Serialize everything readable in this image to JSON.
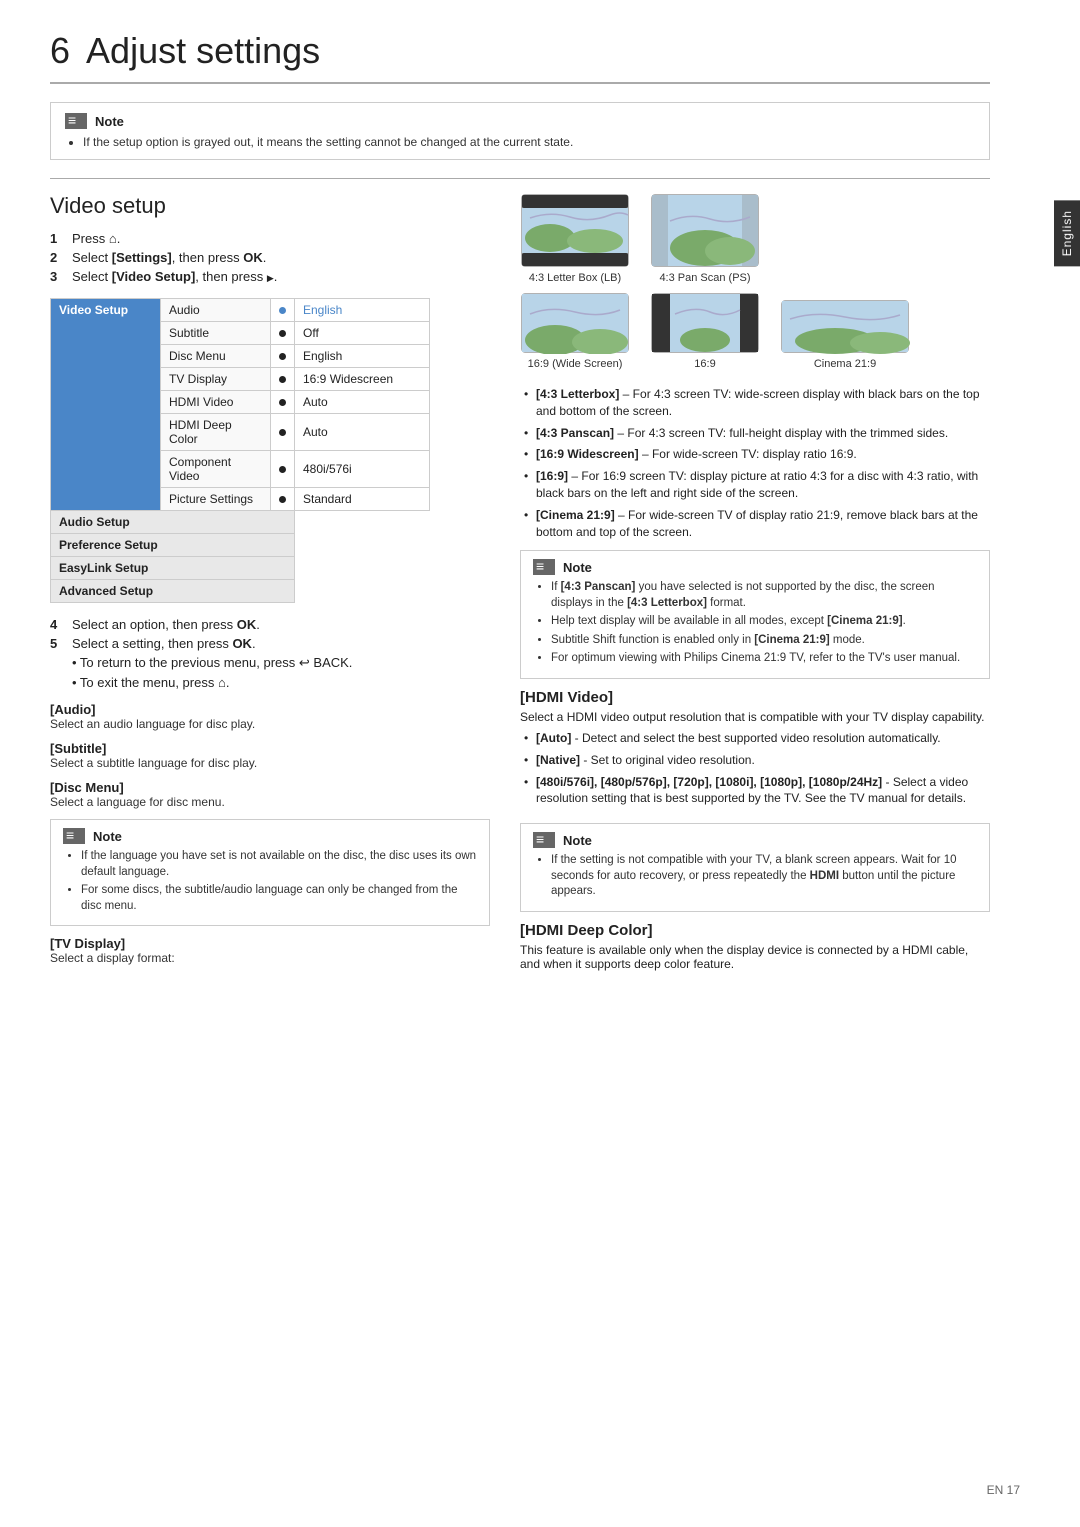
{
  "sidetab": {
    "label": "English"
  },
  "heading": {
    "number": "6",
    "title": "Adjust settings"
  },
  "main_note": {
    "title": "Note",
    "bullets": [
      "If the setup option is grayed out, it means the setting cannot be changed at the current state."
    ]
  },
  "video_setup_section": {
    "title": "Video setup",
    "steps": [
      {
        "num": "1",
        "text": "Press ",
        "icon": "home"
      },
      {
        "num": "2",
        "text": "Select [Settings], then press OK."
      },
      {
        "num": "3",
        "text": "Select [Video Setup], then press ",
        "icon": "arrow-right"
      }
    ],
    "table": {
      "menu_items": [
        {
          "label": "Video Setup",
          "selected": true
        },
        {
          "label": "Audio Setup",
          "selected": false
        },
        {
          "label": "Preference Setup",
          "selected": false
        },
        {
          "label": "EasyLink Setup",
          "selected": false
        },
        {
          "label": "Advanced Setup",
          "selected": false
        }
      ],
      "settings": [
        {
          "label": "Audio",
          "value": "English"
        },
        {
          "label": "Subtitle",
          "value": "Off"
        },
        {
          "label": "Disc Menu",
          "value": "English"
        },
        {
          "label": "TV Display",
          "value": "16:9 Widescreen"
        },
        {
          "label": "HDMI Video",
          "value": "Auto"
        },
        {
          "label": "HDMI Deep Color",
          "value": "Auto"
        },
        {
          "label": "Component Video",
          "value": "480i/576i"
        },
        {
          "label": "Picture Settings",
          "value": "Standard"
        }
      ]
    },
    "steps_below": [
      {
        "num": "4",
        "text": "Select an option, then press OK."
      },
      {
        "num": "5",
        "text": "Select a setting, then press OK."
      }
    ],
    "sub_bullets": [
      {
        "text": "To return to the previous menu, press  BACK."
      },
      {
        "text": "To exit the menu, press ."
      }
    ],
    "audio_section": {
      "title": "[Audio]",
      "body": "Select an audio language for disc play."
    },
    "subtitle_section": {
      "title": "[Subtitle]",
      "body": "Select a subtitle language for disc play."
    },
    "disc_menu_section": {
      "title": "[Disc Menu]",
      "body": "Select a language for disc menu."
    },
    "note2": {
      "title": "Note",
      "bullets": [
        "If the language you have set is not available on the disc, the disc uses its own default language.",
        "For some discs, the subtitle/audio language can only be changed from the disc menu."
      ]
    },
    "tv_display_section": {
      "title": "[TV Display]",
      "body": "Select a display format:"
    }
  },
  "tv_images": {
    "row1": [
      {
        "label": "4:3 Letter Box (LB)",
        "type": "letterbox"
      },
      {
        "label": "4:3 Pan Scan (PS)",
        "type": "panscan"
      }
    ],
    "row2": [
      {
        "label": "16:9 (Wide Screen)",
        "type": "widescreen"
      },
      {
        "label": "16:9",
        "type": "169"
      },
      {
        "label": "Cinema 21:9",
        "type": "cinema219"
      }
    ]
  },
  "tv_display_bullets": [
    "[4:3 Letterbox] – For 4:3 screen TV: wide-screen display with black bars on the top and bottom of the screen.",
    "[4:3 Panscan] – For 4:3 screen TV: full-height display with the trimmed sides.",
    "[16:9 Widescreen] – For wide-screen TV: display ratio 16:9.",
    "[16:9] – For 16:9 screen TV: display picture at ratio 4:3 for a disc with 4:3 ratio, with black bars on the left and right side of the screen.",
    "[Cinema 21:9] – For wide-screen TV of display ratio 21:9, remove black bars at the bottom and top of the screen."
  ],
  "note3": {
    "title": "Note",
    "bullets": [
      "If [4:3 Panscan] you have selected is not supported by the disc, the screen displays in the [4:3 Letterbox] format.",
      "Help text display will be available in all modes, except [Cinema 21:9].",
      "Subtitle Shift function is enabled only in [Cinema 21:9] mode.",
      "For optimum viewing with Philips Cinema 21:9 TV, refer to the TV's user manual."
    ]
  },
  "hdmi_video_section": {
    "title": "[HDMI Video]",
    "body": "Select a HDMI video output resolution that is compatible with your TV display capability.",
    "bullets": [
      "[Auto] - Detect and select the best supported video resolution automatically.",
      "[Native] - Set to original video resolution.",
      "[480i/576i], [480p/576p], [720p], [1080i], [1080p], [1080p/24Hz] - Select a video resolution setting that is best supported by the TV. See the TV manual for details."
    ]
  },
  "note4": {
    "title": "Note",
    "bullets": [
      "If the setting is not compatible with your TV, a blank screen appears. Wait for 10 seconds for auto recovery, or press repeatedly the HDMI button until the picture appears."
    ]
  },
  "hdmi_deep_color_section": {
    "title": "[HDMI Deep Color]",
    "body": "This feature is available only when the display device is connected by a HDMI cable, and when it supports deep color feature."
  },
  "page_number": "EN  17"
}
